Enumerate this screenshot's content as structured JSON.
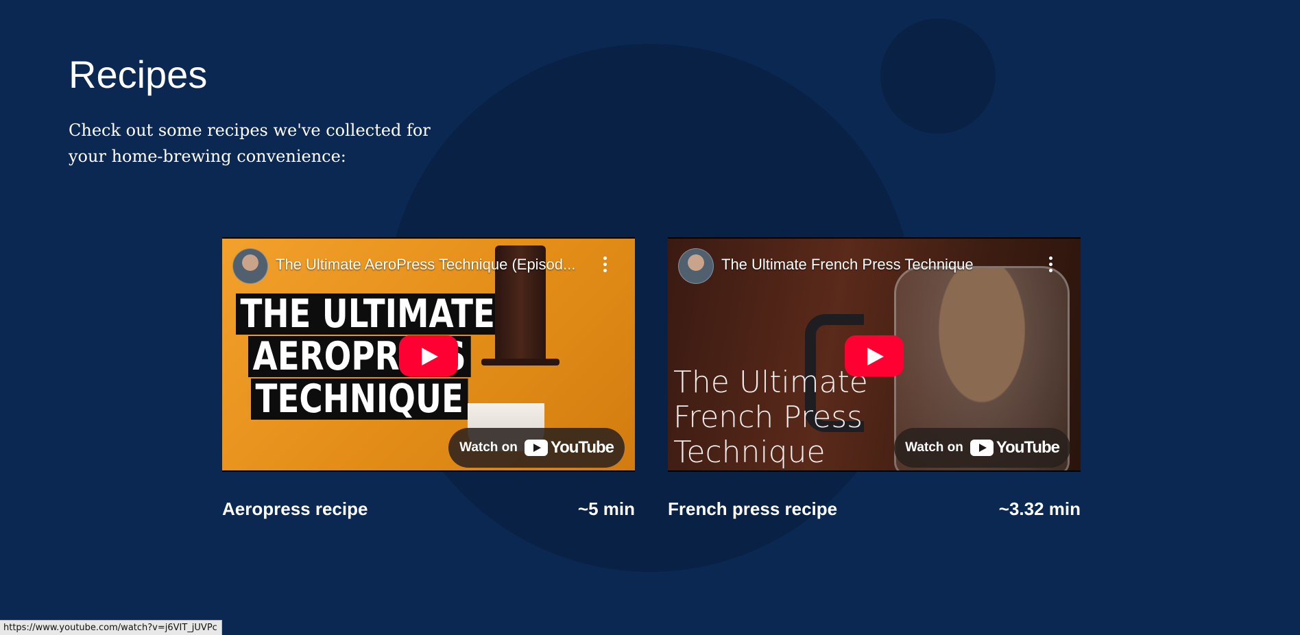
{
  "page": {
    "title": "Recipes",
    "intro": "Check out some recipes we've collected for your home-brewing convenience:"
  },
  "recipes": [
    {
      "video_title": "The Ultimate AeroPress Technique (Episod...",
      "thumbnail_text": [
        "THE ULTIMATE",
        "AEROPRESS",
        "TECHNIQUE"
      ],
      "watch_label": "Watch on",
      "brand": "YouTube",
      "name": "Aeropress recipe",
      "duration": "~5 min"
    },
    {
      "video_title": "The Ultimate French Press Technique",
      "thumbnail_text": [
        "The Ultimate",
        "French Press",
        "Technique"
      ],
      "watch_label": "Watch on",
      "brand": "YouTube",
      "name": "French press recipe",
      "duration": "~3.32 min"
    }
  ],
  "status_bar": {
    "url": "https://www.youtube.com/watch?v=j6VIT_jUVPc"
  },
  "colors": {
    "background": "#0a2852",
    "decor_circle": "#0a2146",
    "youtube_red": "#ff0033"
  }
}
